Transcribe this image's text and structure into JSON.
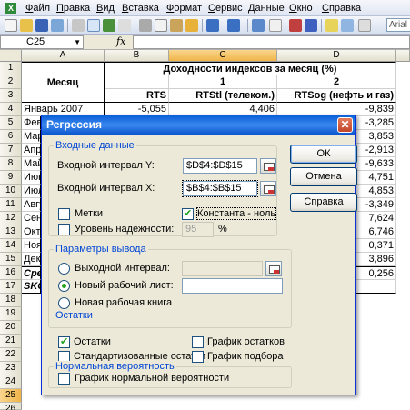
{
  "menubar": {
    "items": [
      "Файл",
      "Правка",
      "Вид",
      "Вставка",
      "Формат",
      "Сервис",
      "Данные",
      "Окно",
      "Справка"
    ]
  },
  "toolbar": {
    "font_name": "Arial"
  },
  "formula_bar": {
    "name_box": "C25",
    "fx_label": "fx",
    "content": ""
  },
  "sheet": {
    "columns": [
      "A",
      "B",
      "C",
      "D"
    ],
    "selected_column": "C",
    "selected_row": "25",
    "rows": [
      "1",
      "2",
      "3",
      "4",
      "5",
      "6",
      "7",
      "8",
      "9",
      "10",
      "11",
      "12",
      "13",
      "14",
      "15",
      "16",
      "17",
      "18",
      "19",
      "20",
      "21",
      "22",
      "23",
      "24",
      "25",
      "26"
    ],
    "header_month": "Месяц",
    "header_group": "Доходности индексов за месяц (%)",
    "header_num_1": "1",
    "header_num_2": "2",
    "col_rts": "RTS",
    "col_rtstl": "RTStl (телеком.)",
    "col_rtsog": "RTSog (нефть и газ)",
    "row4": {
      "month": "Январь 2007",
      "rts": "-5,055",
      "rtstl": "4,406",
      "rtsog": "-9,839"
    },
    "partial_months": [
      "Фев",
      "Мар",
      "Апр",
      "Май",
      "Июн",
      "Июл",
      "Авгу",
      "Сент",
      "Октя",
      "Ноя",
      "Дека",
      "Сред",
      "SKO"
    ],
    "d_values": [
      "-3,285",
      "3,853",
      "-2,913",
      "-9,633",
      "4,751",
      "4,853",
      "-3,349",
      "7,624",
      "6,746",
      "0,371",
      "3,896",
      "0,256"
    ]
  },
  "dialog": {
    "title": "Регрессия",
    "input_group": "Входные данные",
    "input_y_label": "Входной интервал Y:",
    "input_y_value": "$D$4:$D$15",
    "input_x_label": "Входной интервал X:",
    "input_x_value": "$B$4:$B$15",
    "labels_check": "Метки",
    "constant_zero_check": "Константа - ноль",
    "confidence_check": "Уровень надежности:",
    "confidence_value": "95",
    "percent": "%",
    "output_group": "Параметры вывода",
    "output_range_radio": "Выходной интервал:",
    "new_sheet_radio": "Новый рабочий лист:",
    "new_book_radio": "Новая рабочая книга",
    "residuals_group": "Остатки",
    "residuals_check": "Остатки",
    "std_residuals_check": "Стандартизованные остатки",
    "residual_plot_check": "График остатков",
    "line_fit_check": "График подбора",
    "normal_group": "Нормальная вероятность",
    "normal_plot_check": "График нормальной вероятности",
    "ok_button": "ОК",
    "cancel_button": "Отмена",
    "help_button": "Справка",
    "close_glyph": "✕"
  }
}
